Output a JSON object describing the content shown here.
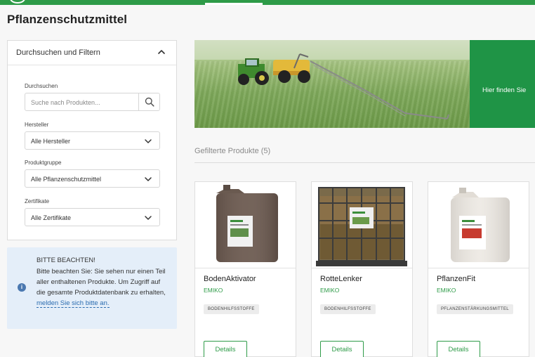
{
  "page": {
    "title": "Pflanzenschutzmittel"
  },
  "filter": {
    "header": "Durchsuchen und Filtern",
    "search": {
      "label": "Durchsuchen",
      "placeholder": "Suche nach Produkten..."
    },
    "manufacturer": {
      "label": "Hersteller",
      "value": "Alle Hersteller"
    },
    "product_group": {
      "label": "Produktgruppe",
      "value": "Alle Pflanzenschutzmittel"
    },
    "certificates": {
      "label": "Zertifikate",
      "value": "Alle Zertifikate"
    }
  },
  "notice": {
    "heading": "BITTE BEACHTEN!",
    "body": "Bitte beachten Sie: Sie sehen nur einen Teil aller enthaltenen Produkte. Um Zugriff auf die gesamte Produktdatenbank zu erhalten, ",
    "link": "melden Sie sich bitte an."
  },
  "banner": {
    "text": "Hier finden Sie"
  },
  "products": {
    "section_label": "Gefilterte Produkte (5)",
    "items": [
      {
        "name": "BodenAktivator",
        "brand": "EMIKO",
        "tag": "BODENHILFSSTOFFE",
        "button": "Details"
      },
      {
        "name": "RotteLenker",
        "brand": "EMIKO",
        "tag": "BODENHILFSSTOFFE",
        "button": "Details"
      },
      {
        "name": "PflanzenFit",
        "brand": "EMIKO",
        "tag": "PFLANZENSTÄRKUNGSMITTEL",
        "button": "Details"
      }
    ]
  },
  "colors": {
    "brand_green": "#2e9b48",
    "notice_bg": "#e4eef9",
    "link_blue": "#2b6cb0"
  },
  "icons": {
    "collapse": "chevron-up-icon",
    "dropdown": "chevron-down-icon",
    "search": "search-icon",
    "info": "info-icon"
  }
}
